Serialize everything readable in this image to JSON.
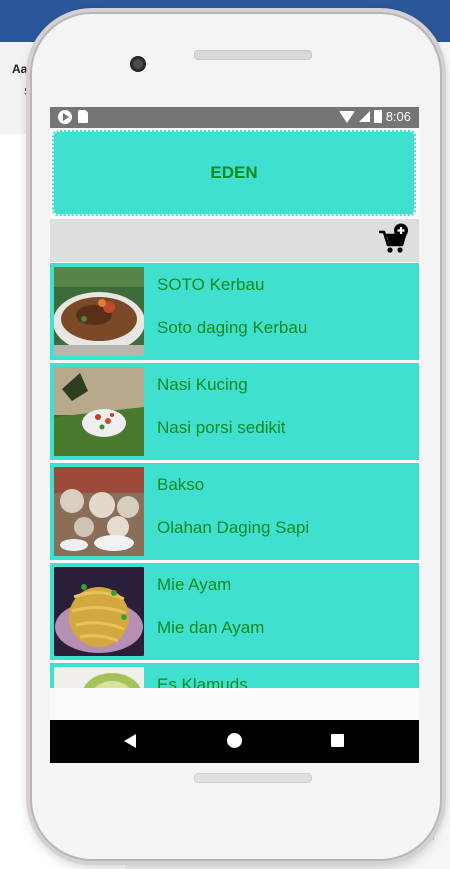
{
  "background": {
    "ribbon_title": "Aa",
    "ribbon_sub": "S"
  },
  "status_bar": {
    "time": "8:06"
  },
  "app": {
    "title": "EDEN",
    "accent_color": "#3fe0d0",
    "text_color": "#128a20"
  },
  "toolbar": {
    "cart_icon": "add-to-cart-icon"
  },
  "menu_items": [
    {
      "name": "SOTO Kerbau",
      "desc": "Soto daging Kerbau",
      "image": "soto-bowl"
    },
    {
      "name": "Nasi Kucing",
      "desc": "Nasi porsi sedikit",
      "image": "rice-on-leaf"
    },
    {
      "name": "Bakso",
      "desc": "Olahan Daging Sapi",
      "image": "meatballs"
    },
    {
      "name": "Mie Ayam",
      "desc": "Mie dan Ayam",
      "image": "noodles"
    },
    {
      "name": "Es Klamuds",
      "desc": "",
      "image": "coconut"
    }
  ]
}
